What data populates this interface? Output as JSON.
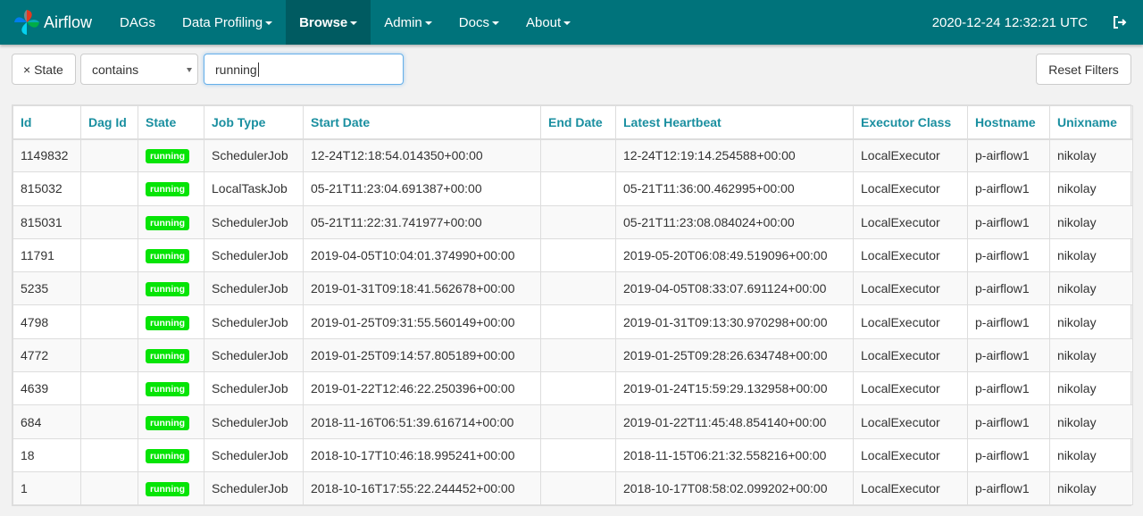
{
  "navbar": {
    "brand": "Airflow",
    "items": [
      {
        "label": "DAGs",
        "dropdown": false,
        "active": false
      },
      {
        "label": "Data Profiling",
        "dropdown": true,
        "active": false
      },
      {
        "label": "Browse",
        "dropdown": true,
        "active": true
      },
      {
        "label": "Admin",
        "dropdown": true,
        "active": false
      },
      {
        "label": "Docs",
        "dropdown": true,
        "active": false
      },
      {
        "label": "About",
        "dropdown": true,
        "active": false
      }
    ],
    "time": "2020-12-24 12:32:21 UTC",
    "logout_icon": "sign-out-icon"
  },
  "filters": {
    "chip_label": "× State",
    "operator": "contains",
    "value": "running",
    "reset_label": "Reset Filters"
  },
  "table": {
    "columns": [
      "Id",
      "Dag Id",
      "State",
      "Job Type",
      "Start Date",
      "End Date",
      "Latest Heartbeat",
      "Executor Class",
      "Hostname",
      "Unixname"
    ],
    "rows": [
      {
        "id": "1149832",
        "dag_id": "",
        "state": "running",
        "job_type": "SchedulerJob",
        "start": "12-24T12:18:54.014350+00:00",
        "end": "",
        "heartbeat": "12-24T12:19:14.254588+00:00",
        "executor": "LocalExecutor",
        "host": "p-airflow1",
        "unix": "nikolay"
      },
      {
        "id": "815032",
        "dag_id": "",
        "state": "running",
        "job_type": "LocalTaskJob",
        "start": "05-21T11:23:04.691387+00:00",
        "end": "",
        "heartbeat": "05-21T11:36:00.462995+00:00",
        "executor": "LocalExecutor",
        "host": "p-airflow1",
        "unix": "nikolay"
      },
      {
        "id": "815031",
        "dag_id": "",
        "state": "running",
        "job_type": "SchedulerJob",
        "start": "05-21T11:22:31.741977+00:00",
        "end": "",
        "heartbeat": "05-21T11:23:08.084024+00:00",
        "executor": "LocalExecutor",
        "host": "p-airflow1",
        "unix": "nikolay"
      },
      {
        "id": "11791",
        "dag_id": "",
        "state": "running",
        "job_type": "SchedulerJob",
        "start": "2019-04-05T10:04:01.374990+00:00",
        "end": "",
        "heartbeat": "2019-05-20T06:08:49.519096+00:00",
        "executor": "LocalExecutor",
        "host": "p-airflow1",
        "unix": "nikolay"
      },
      {
        "id": "5235",
        "dag_id": "",
        "state": "running",
        "job_type": "SchedulerJob",
        "start": "2019-01-31T09:18:41.562678+00:00",
        "end": "",
        "heartbeat": "2019-04-05T08:33:07.691124+00:00",
        "executor": "LocalExecutor",
        "host": "p-airflow1",
        "unix": "nikolay"
      },
      {
        "id": "4798",
        "dag_id": "",
        "state": "running",
        "job_type": "SchedulerJob",
        "start": "2019-01-25T09:31:55.560149+00:00",
        "end": "",
        "heartbeat": "2019-01-31T09:13:30.970298+00:00",
        "executor": "LocalExecutor",
        "host": "p-airflow1",
        "unix": "nikolay"
      },
      {
        "id": "4772",
        "dag_id": "",
        "state": "running",
        "job_type": "SchedulerJob",
        "start": "2019-01-25T09:14:57.805189+00:00",
        "end": "",
        "heartbeat": "2019-01-25T09:28:26.634748+00:00",
        "executor": "LocalExecutor",
        "host": "p-airflow1",
        "unix": "nikolay"
      },
      {
        "id": "4639",
        "dag_id": "",
        "state": "running",
        "job_type": "SchedulerJob",
        "start": "2019-01-22T12:46:22.250396+00:00",
        "end": "",
        "heartbeat": "2019-01-24T15:59:29.132958+00:00",
        "executor": "LocalExecutor",
        "host": "p-airflow1",
        "unix": "nikolay"
      },
      {
        "id": "684",
        "dag_id": "",
        "state": "running",
        "job_type": "SchedulerJob",
        "start": "2018-11-16T06:51:39.616714+00:00",
        "end": "",
        "heartbeat": "2019-01-22T11:45:48.854140+00:00",
        "executor": "LocalExecutor",
        "host": "p-airflow1",
        "unix": "nikolay"
      },
      {
        "id": "18",
        "dag_id": "",
        "state": "running",
        "job_type": "SchedulerJob",
        "start": "2018-10-17T10:46:18.995241+00:00",
        "end": "",
        "heartbeat": "2018-11-15T06:21:32.558216+00:00",
        "executor": "LocalExecutor",
        "host": "p-airflow1",
        "unix": "nikolay"
      },
      {
        "id": "1",
        "dag_id": "",
        "state": "running",
        "job_type": "SchedulerJob",
        "start": "2018-10-16T17:55:22.244452+00:00",
        "end": "",
        "heartbeat": "2018-10-17T08:58:02.099202+00:00",
        "executor": "LocalExecutor",
        "host": "p-airflow1",
        "unix": "nikolay"
      }
    ]
  },
  "colors": {
    "navbar": "#00737b",
    "navbar_active": "#005b61",
    "header_text": "#1a8fa0",
    "badge_running": "#06e406"
  }
}
